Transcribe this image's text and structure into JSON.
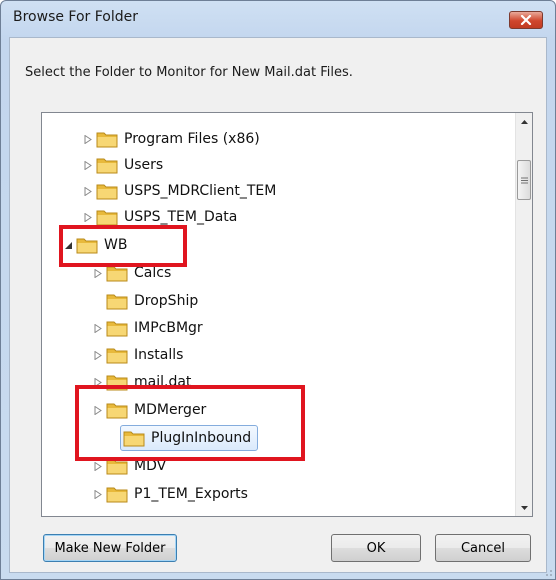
{
  "window": {
    "title": "Browse For Folder",
    "instruction": "Select the Folder to Monitor for New Mail.dat Files."
  },
  "tree": {
    "rows": [
      {
        "label": "Program Files (x86)",
        "expander": "collapsed"
      },
      {
        "label": "Users",
        "expander": "collapsed"
      },
      {
        "label": "USPS_MDRClient_TEM",
        "expander": "collapsed"
      },
      {
        "label": "USPS_TEM_Data",
        "expander": "collapsed"
      },
      {
        "label": "WB",
        "expander": "expanded"
      },
      {
        "label": "Calcs",
        "expander": "collapsed"
      },
      {
        "label": "DropShip",
        "expander": "none"
      },
      {
        "label": "IMPcBMgr",
        "expander": "collapsed"
      },
      {
        "label": "Installs",
        "expander": "collapsed"
      },
      {
        "label": "mail.dat",
        "expander": "collapsed"
      },
      {
        "label": "MDMerger",
        "expander": "collapsed"
      },
      {
        "label": "PlugInInbound",
        "expander": "none",
        "selected": true
      },
      {
        "label": "MDV",
        "expander": "collapsed"
      },
      {
        "label": "P1_TEM_Exports",
        "expander": "collapsed"
      }
    ]
  },
  "buttons": {
    "make_new_folder": "Make New Folder",
    "ok": "OK",
    "cancel": "Cancel"
  },
  "colors": {
    "highlight": "#e0151f",
    "folder": "#e8b93b",
    "selection": "#dbeafc"
  },
  "icons": {
    "close": "close-icon",
    "folder": "folder-icon",
    "expand": "triangle-right-icon",
    "collapse": "triangle-down-icon"
  }
}
